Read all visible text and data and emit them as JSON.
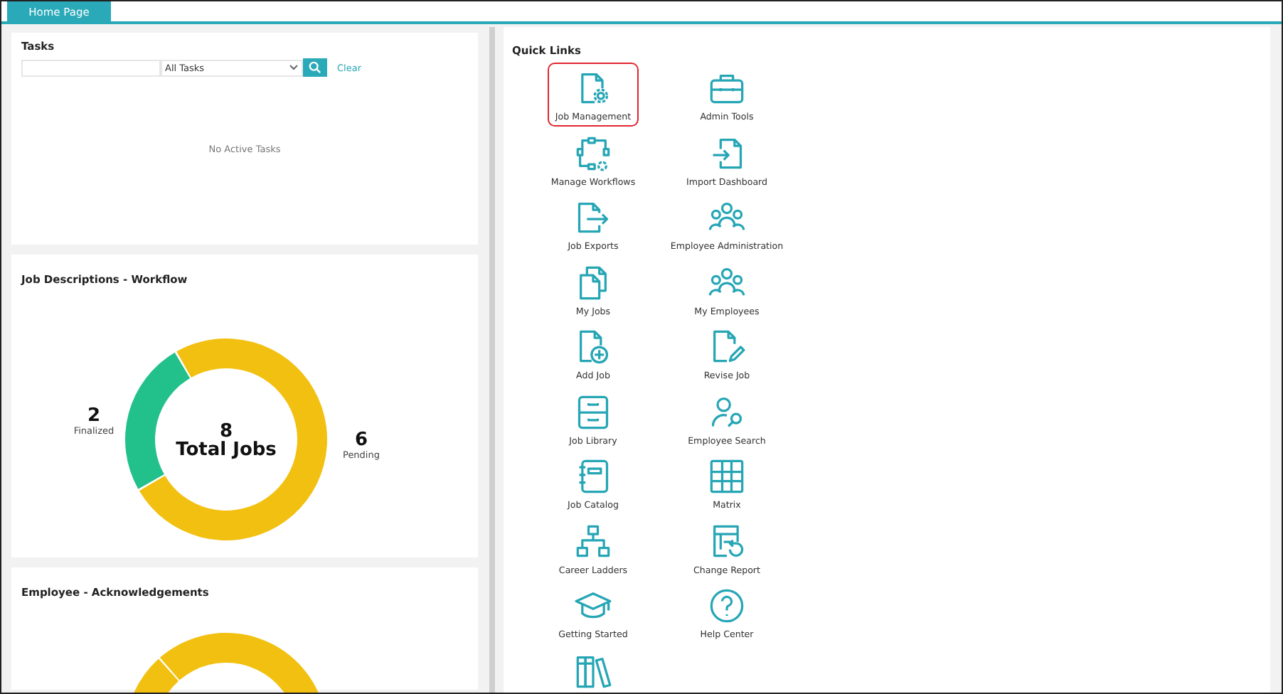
{
  "tabs": [
    {
      "label": "Home Page",
      "selected": true
    }
  ],
  "tasks": {
    "title": "Tasks",
    "filter": {
      "value": "All Tasks"
    },
    "clear": "Clear",
    "empty": "No Active Tasks"
  },
  "workflow": {
    "title": "Job Descriptions - Workflow",
    "center_value": "8",
    "center_label": "Total Jobs",
    "segments": [
      {
        "value": "2",
        "color": "#22c08a"
      },
      {
        "value": "6",
        "color": "#f2c011"
      }
    ],
    "chart_data": {
      "type": "donut",
      "categories": [
        "Finalized",
        "Pending"
      ],
      "values": [
        2,
        6
      ],
      "data_labels": true
    }
  },
  "acknowledgements": {
    "title": "Employee - Acknowledgements"
  },
  "quick_links": {
    "title": "Quick Links",
    "items": [
      {
        "label": "Job Management",
        "selected": true
      },
      {
        "label": "Admin Tools",
        "selected": false
      },
      {
        "label": "Manage Workflows",
        "selected": false
      },
      {
        "label": "Import Dashboard",
        "selected": false
      },
      {
        "label": "Job Exports",
        "selected": false
      },
      {
        "label": "Employee Administration",
        "selected": false
      },
      {
        "label": "My Jobs",
        "selected": false
      },
      {
        "label": "My Employees",
        "selected": false
      },
      {
        "label": "Add Job",
        "selected": false
      },
      {
        "label": "Revise Job",
        "selected": false
      },
      {
        "label": "Job Library",
        "selected": false
      },
      {
        "label": "Employee Search",
        "selected": false
      },
      {
        "label": "Job Catalog",
        "selected": false
      },
      {
        "label": "Matrix",
        "selected": false
      },
      {
        "label": "Career Ladders",
        "selected": false
      },
      {
        "label": "Change Report",
        "selected": false
      },
      {
        "label": "Getting Started",
        "selected": false
      },
      {
        "label": "Help Center",
        "selected": false
      },
      {
        "selected": false
      }
    ]
  }
}
